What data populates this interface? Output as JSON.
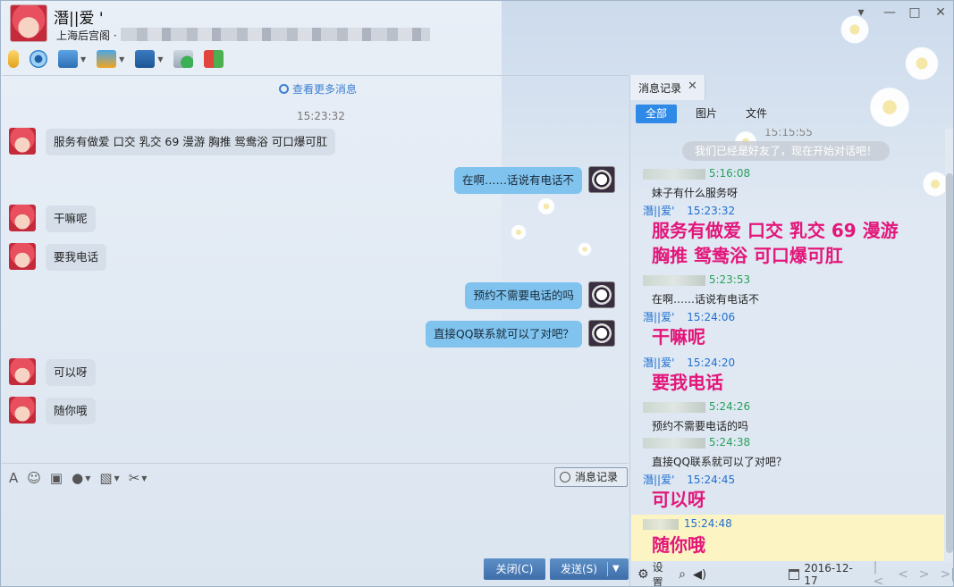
{
  "contact": {
    "name": "潛||爱 '",
    "location": "上海后宫阁 ·"
  },
  "window_controls": {
    "dropdown": "▾",
    "minimize": "—",
    "maximize": "□",
    "close": "✕"
  },
  "chat": {
    "more_messages": "查看更多消息",
    "timestamp": "15:23:32",
    "messages": [
      {
        "side": "left",
        "text": "服务有做爱 口交 乳交 69  漫游 胸推 鸳鸯浴 可口爆可肛"
      },
      {
        "side": "right",
        "text": "在啊……话说有电话不"
      },
      {
        "side": "left",
        "text": "干嘛呢"
      },
      {
        "side": "left",
        "text": "要我电话"
      },
      {
        "side": "right",
        "text": "预约不需要电话的吗"
      },
      {
        "side": "right",
        "text": "直接QQ联系就可以了对吧？"
      },
      {
        "side": "left",
        "text": "可以呀"
      },
      {
        "side": "left",
        "text": "随你哦"
      }
    ]
  },
  "input": {
    "history_button": "消息记录",
    "close_button": "关闭(C)",
    "send_button": "发送(S)"
  },
  "history": {
    "tab_label": "消息记录",
    "filters": [
      "全部",
      "图片",
      "文件"
    ],
    "top_time": "15:15:55",
    "notice": "我们已经是好友了，现在开始对话吧！",
    "entries": [
      {
        "name": "",
        "time": "5:16:08",
        "text": "妹子有什么服务呀",
        "style": "small"
      },
      {
        "name": "潛||爱'",
        "time": "15:23:32",
        "text": "服务有做爱 口交 乳交 69  漫游",
        "text2": "胸推 鸳鸯浴 可口爆可肛",
        "style": "big"
      },
      {
        "name": "",
        "time": "5:23:53",
        "text": "在啊……话说有电话不",
        "style": "small"
      },
      {
        "name": "潛||爱'",
        "time": "15:24:06",
        "text": "干嘛呢",
        "style": "big"
      },
      {
        "name": "潛||爱'",
        "time": "15:24:20",
        "text": "要我电话",
        "style": "big"
      },
      {
        "name": "",
        "time": "5:24:26",
        "text": "预约不需要电话的吗",
        "style": "small"
      },
      {
        "name": "",
        "time": "5:24:38",
        "text": "直接QQ联系就可以了对吧？",
        "style": "small"
      },
      {
        "name": "潛||爱'",
        "time": "15:24:45",
        "text": "可以呀",
        "style": "big"
      },
      {
        "name": "",
        "time": "15:24:48",
        "text": "随你哦",
        "style": "big"
      }
    ],
    "footer": {
      "settings": "设置",
      "date": "2016-12-17"
    }
  }
}
